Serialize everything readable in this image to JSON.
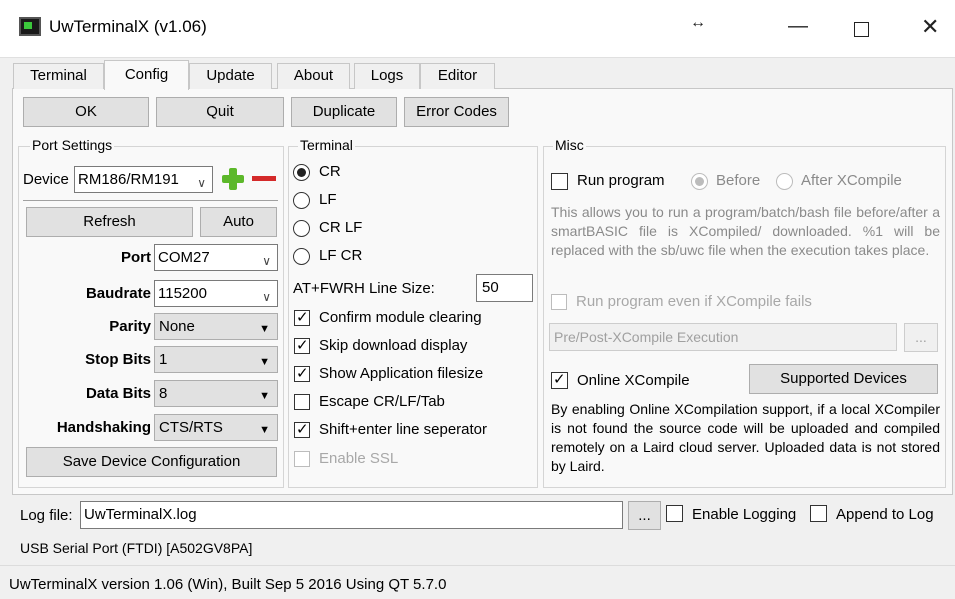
{
  "window": {
    "title": "UwTerminalX (v1.06)"
  },
  "tabs": [
    "Terminal",
    "Config",
    "Update",
    "About",
    "Logs",
    "Editor"
  ],
  "toolbar": {
    "ok": "OK",
    "quit": "Quit",
    "duplicate": "Duplicate",
    "error_codes": "Error Codes"
  },
  "port_settings": {
    "title": "Port Settings",
    "device_label": "Device",
    "device_value": "RM186/RM191",
    "refresh": "Refresh",
    "auto": "Auto",
    "port_label": "Port",
    "port_value": "COM27",
    "baudrate_label": "Baudrate",
    "baudrate_value": "115200",
    "parity_label": "Parity",
    "parity_value": "None",
    "stopbits_label": "Stop Bits",
    "stopbits_value": "1",
    "databits_label": "Data Bits",
    "databits_value": "8",
    "handshaking_label": "Handshaking",
    "handshaking_value": "CTS/RTS",
    "save": "Save Device Configuration"
  },
  "terminal": {
    "title": "Terminal",
    "radios": [
      "CR",
      "LF",
      "CR LF",
      "LF CR"
    ],
    "line_size_label": "AT+FWRH Line Size:",
    "line_size_value": "50",
    "checks": [
      {
        "label": "Confirm module clearing",
        "checked": true
      },
      {
        "label": "Skip download display",
        "checked": true
      },
      {
        "label": "Show Application filesize",
        "checked": true
      },
      {
        "label": "Escape CR/LF/Tab",
        "checked": false
      },
      {
        "label": "Shift+enter line seperator",
        "checked": true
      },
      {
        "label": "Enable SSL",
        "checked": false
      }
    ]
  },
  "misc": {
    "title": "Misc",
    "run_program": "Run program",
    "before": "Before",
    "after": "After XCompile",
    "description": "This allows you to run a program/batch/bash file before/after a smartBASIC file is XCompiled/ downloaded. %1 will be replaced with the sb/uwc file when the execution takes place.",
    "run_even_if_fails": "Run program even if XCompile fails",
    "exec_placeholder": "Pre/Post-XCompile Execution",
    "browse": "...",
    "online_xcompile": "Online XCompile",
    "supported_devices": "Supported Devices",
    "online_description": "By enabling Online XCompilation support, if a local XCompiler is not found the source code will be uploaded and compiled remotely on a Laird cloud server. Uploaded data is not stored by Laird."
  },
  "log": {
    "label": "Log file:",
    "value": "UwTerminalX.log",
    "browse": "...",
    "enable_logging": "Enable Logging",
    "append": "Append to Log"
  },
  "status": {
    "port_info": "USB Serial Port (FTDI) [A502GV8PA]",
    "version": "UwTerminalX version 1.06 (Win), Built Sep  5 2016 Using QT 5.7.0"
  }
}
